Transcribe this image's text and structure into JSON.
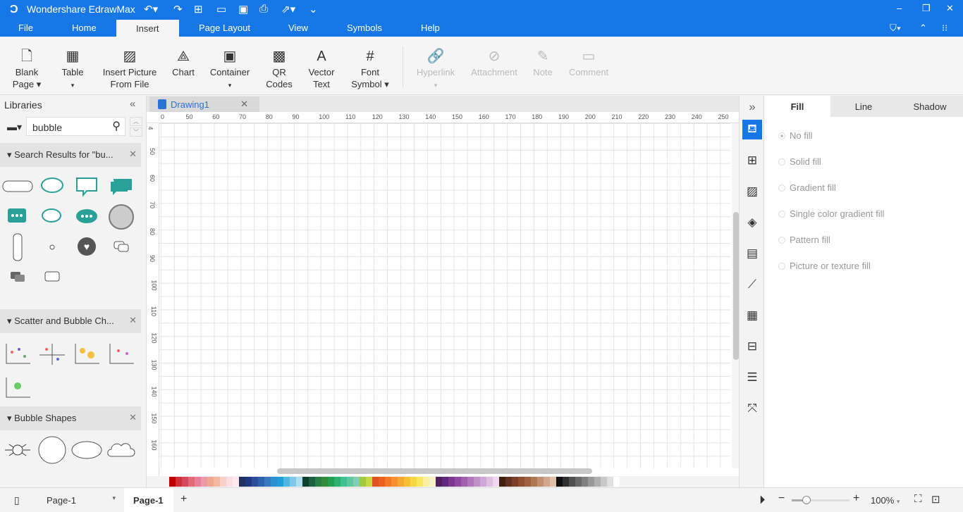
{
  "app": {
    "title": "Wondershare EdrawMax",
    "accent": "#1877e6"
  },
  "menu": [
    "File",
    "Home",
    "Insert",
    "Page Layout",
    "View",
    "Symbols",
    "Help"
  ],
  "active_menu": "Insert",
  "ribbon": [
    {
      "l1": "Blank",
      "l2": "Page ▾",
      "icon": "blank-page-icon"
    },
    {
      "l1": "Table",
      "l2": "▾",
      "icon": "table-icon"
    },
    {
      "l1": "Insert Picture",
      "l2": "From File",
      "icon": "picture-icon"
    },
    {
      "l1": "Chart",
      "l2": "",
      "icon": "chart-icon"
    },
    {
      "l1": "Container",
      "l2": "▾",
      "icon": "container-icon"
    },
    {
      "l1": "QR",
      "l2": "Codes",
      "icon": "qr-code-icon"
    },
    {
      "l1": "Vector",
      "l2": "Text",
      "icon": "vector-text-icon"
    },
    {
      "l1": "Font",
      "l2": "Symbol ▾",
      "icon": "font-symbol-icon"
    },
    {
      "l1": "Hyperlink",
      "l2": "▾",
      "icon": "hyperlink-icon",
      "disabled": true
    },
    {
      "l1": "Attachment",
      "l2": "",
      "icon": "attachment-icon",
      "disabled": true
    },
    {
      "l1": "Note",
      "l2": "",
      "icon": "note-icon",
      "disabled": true
    },
    {
      "l1": "Comment",
      "l2": "",
      "icon": "comment-icon",
      "disabled": true
    }
  ],
  "libraries": {
    "title": "Libraries",
    "search_value": "bubble",
    "sections": [
      {
        "title": "Search Results for  \"bu..."
      },
      {
        "title": "Scatter and Bubble Ch..."
      },
      {
        "title": "Bubble Shapes"
      }
    ]
  },
  "document_tab": "Drawing1",
  "hruler": [
    "0",
    "50",
    "60",
    "70",
    "80",
    "90",
    "100",
    "110",
    "120",
    "130",
    "140",
    "150",
    "160",
    "170",
    "180",
    "190",
    "200",
    "210",
    "220",
    "230",
    "240",
    "250"
  ],
  "vruler": [
    "4",
    "50",
    "60",
    "70",
    "80",
    "90",
    "100",
    "110",
    "120",
    "130",
    "140",
    "150",
    "160"
  ],
  "palette": [
    "#c00000",
    "#d0303a",
    "#d44a5c",
    "#e06a7a",
    "#e8809a",
    "#ec9aa8",
    "#f0a890",
    "#f4b8a0",
    "#f8d0c8",
    "#fce0e0",
    "#ffe8f0",
    "#203060",
    "#203880",
    "#2c4c9c",
    "#3060b0",
    "#3c78c0",
    "#2c90d0",
    "#20a0d8",
    "#50b8e0",
    "#80c8e8",
    "#b0dcf0",
    "#104030",
    "#1c6040",
    "#2c7c48",
    "#308c38",
    "#20a050",
    "#30b070",
    "#40c090",
    "#60c8a0",
    "#80d0b0",
    "#a0c840",
    "#c8d840",
    "#e05020",
    "#e86020",
    "#f07828",
    "#f89030",
    "#f8a830",
    "#f8c030",
    "#f8d840",
    "#f8e860",
    "#f8f0a0",
    "#f8f0c8",
    "#502060",
    "#602880",
    "#7c3890",
    "#9048a0",
    "#a060b0",
    "#b078c0",
    "#c090c8",
    "#d0a8d8",
    "#e0c0e0",
    "#f0d8f0",
    "#402010",
    "#603020",
    "#7c4028",
    "#905030",
    "#a06040",
    "#b07850",
    "#c09070",
    "#d0a890",
    "#e0c0a8",
    "#101010",
    "#303030",
    "#505050",
    "#686868",
    "#808080",
    "#989898",
    "#b0b0b0",
    "#c8c8c8",
    "#e0e0e0",
    "#ffffff"
  ],
  "right_panel": {
    "tabs": [
      "Fill",
      "Line",
      "Shadow"
    ],
    "active": "Fill",
    "options": [
      "No fill",
      "Solid fill",
      "Gradient fill",
      "Single color gradient fill",
      "Pattern fill",
      "Picture or texture fill"
    ]
  },
  "status": {
    "page_select": "Page-1",
    "page_tab": "Page-1",
    "zoom": "100%",
    "zoom_level_percent": 100
  }
}
